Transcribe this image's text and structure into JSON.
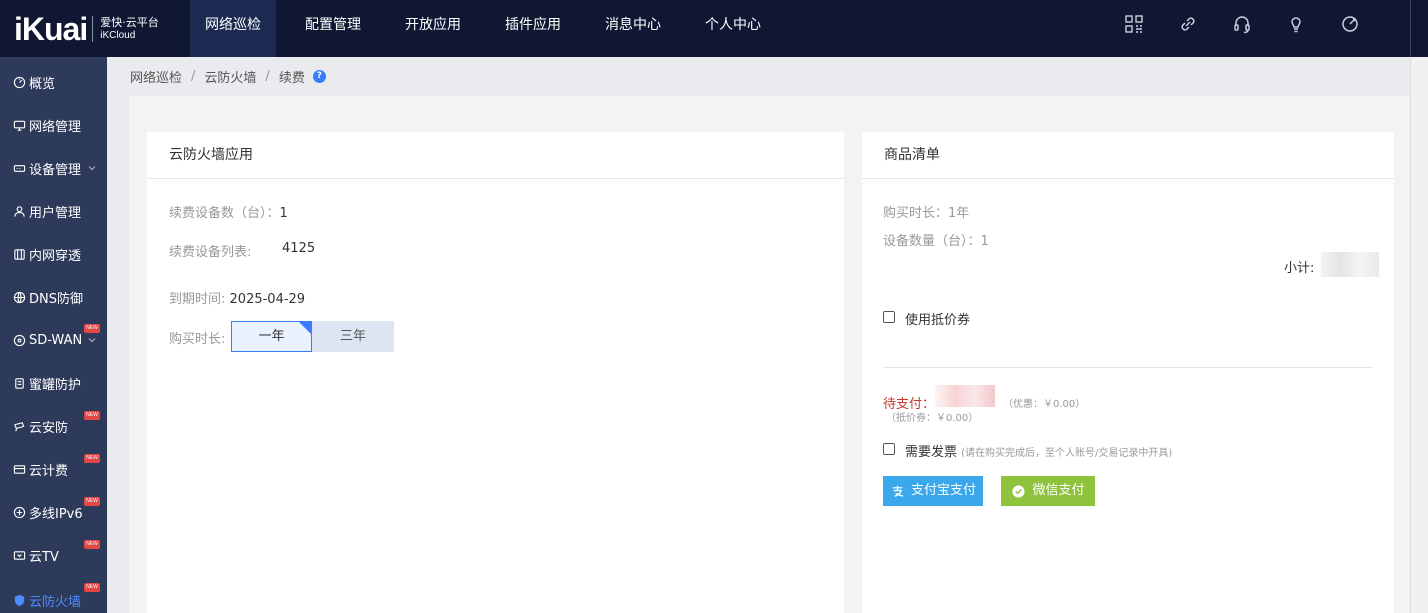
{
  "logo": {
    "mark": "iKuai",
    "line1": "爱快·云平台",
    "line2": "iKCloud"
  },
  "nav": [
    "网络巡检",
    "配置管理",
    "开放应用",
    "插件应用",
    "消息中心",
    "个人中心"
  ],
  "top_icons": [
    "grid-icon",
    "link-icon",
    "headset-icon",
    "bulb-icon",
    "rocket-icon",
    "more-icon"
  ],
  "sidebar": {
    "items": [
      {
        "label": "概览",
        "icon": "dashboard-icon",
        "badge": "",
        "chevron": false
      },
      {
        "label": "网络管理",
        "icon": "monitor-icon",
        "badge": "",
        "chevron": false
      },
      {
        "label": "设备管理",
        "icon": "device-icon",
        "badge": "",
        "chevron": true
      },
      {
        "label": "用户管理",
        "icon": "user-icon",
        "badge": "",
        "chevron": false
      },
      {
        "label": "内网穿透",
        "icon": "tunnel-icon",
        "badge": "",
        "chevron": false
      },
      {
        "label": "DNS防御",
        "icon": "dns-icon",
        "badge": "",
        "chevron": false
      },
      {
        "label": "SD-WAN",
        "icon": "sdwan-icon",
        "badge": "NEW",
        "chevron": true
      },
      {
        "label": "蜜罐防护",
        "icon": "honeypot-icon",
        "badge": "",
        "chevron": false
      },
      {
        "label": "云安防",
        "icon": "camera-icon",
        "badge": "NEW",
        "chevron": false
      },
      {
        "label": "云计费",
        "icon": "billing-icon",
        "badge": "NEW",
        "chevron": false
      },
      {
        "label": "多线IPv6",
        "icon": "ipv6-icon",
        "badge": "NEW",
        "chevron": false
      },
      {
        "label": "云TV",
        "icon": "tv-icon",
        "badge": "NEW",
        "chevron": false
      },
      {
        "label": "云防火墙",
        "icon": "shield-icon",
        "badge": "NEW",
        "chevron": false
      }
    ]
  },
  "breadcrumb": [
    "网络巡检",
    "云防火墙",
    "续费"
  ],
  "left_card": {
    "title": "云防火墙应用",
    "renew_count_label": "续费设备数（台）：",
    "renew_count_value": "1",
    "device_list_label": "续费设备列表:",
    "device_list_value": "4125",
    "expire_label": "到期时间:",
    "expire_value": "2025-04-29",
    "duration_label": "购买时长:",
    "duration_options": [
      "一年",
      "三年"
    ],
    "duration_selected": "一年"
  },
  "right_card": {
    "title": "商品清单",
    "buy_duration": "购买时长：1年",
    "device_count": "设备数量（台）：1",
    "subtotal_label": "小计:",
    "voucher_label": "使用抵价券",
    "pending_label": "待支付：",
    "discount_text": "（优惠：￥0.00）",
    "voucher_amount_text": "（抵价券：￥0.00）",
    "invoice_label": "需要发票",
    "invoice_hint": "(请在购买完成后，至个人账号/交易记录中开具)",
    "alipay_label": "支付宝支付",
    "wechat_label": "微信支付"
  },
  "colors": {
    "topbar": "#0f1732",
    "sidebar": "#2d3a5a",
    "accent": "#3b7cff",
    "alipay": "#3ba8ec",
    "wechat": "#8fc33d",
    "badge": "#e54545",
    "pending": "#c0392b"
  }
}
